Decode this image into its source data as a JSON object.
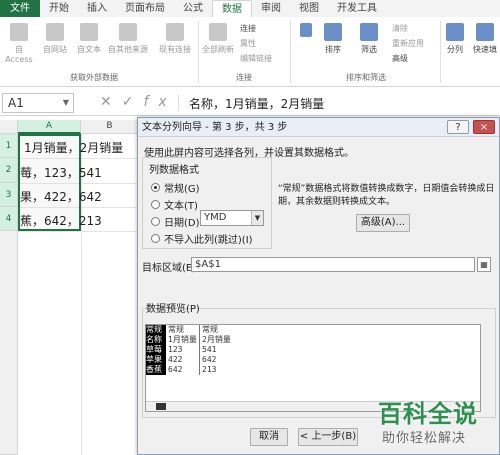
{
  "ribbon": {
    "tabs": [
      "文件",
      "开始",
      "插入",
      "页面布局",
      "公式",
      "数据",
      "审阅",
      "视图",
      "开发工具"
    ],
    "active_tab": "数据",
    "get_external_group": {
      "buttons": [
        "自 Access",
        "自网站",
        "自文本",
        "自其他来源",
        "现有连接"
      ],
      "label": "获取外部数据"
    },
    "connections_group": {
      "refresh_label": "全部刷新",
      "items": [
        "连接",
        "属性",
        "编辑链接"
      ],
      "label": "连接"
    },
    "sort_filter_group": {
      "sort_label": "排序",
      "filter_label": "筛选",
      "items": [
        "清除",
        "重新应用",
        "高级"
      ],
      "label": "排序和筛选"
    },
    "tools": [
      "分列",
      "快速填"
    ]
  },
  "formula_bar": {
    "name_box": "A1",
    "formula": "名称，1月销量，2月销量"
  },
  "sheet": {
    "columns": [
      "A",
      "B"
    ],
    "rows": [
      "1",
      "2",
      "3",
      "4"
    ],
    "cells": [
      "1月销量，2月销量",
      "莓，123，541",
      "果，422，642",
      "蕉，642，213"
    ]
  },
  "dialog": {
    "title": "文本分列向导 - 第 3 步，共 3 步",
    "help": "?",
    "close": "×",
    "instruction": "使用此屏内容可选择各列，并设置其数据格式。",
    "format_legend": "列数据格式",
    "options": [
      "常规(G)",
      "文本(T)",
      "日期(D):",
      "不导入此列(跳过)(I)"
    ],
    "selected_option": "常规(G)",
    "date_format": "YMD",
    "note_line1": "“常规”数据格式将数值转换成数字，日期值会转换成日",
    "note_line2": "期，其余数据则转换成文本。",
    "advanced_button": "高级(A)...",
    "target_label": "目标区域(E):",
    "target_value": "$A$1",
    "preview_legend": "数据预览(P)",
    "preview_columns": [
      [
        "常规",
        "名称",
        "草莓",
        "苹果",
        "香蕉"
      ],
      [
        "常规",
        "1月销量",
        "123",
        "422",
        "642"
      ],
      [
        "常规",
        "2月销量",
        "541",
        "642",
        "213"
      ]
    ],
    "cancel_button": "取消",
    "back_button": "< 上一步(B)"
  },
  "watermark": {
    "title": "百科全说",
    "subtitle": "助你轻松解决"
  }
}
